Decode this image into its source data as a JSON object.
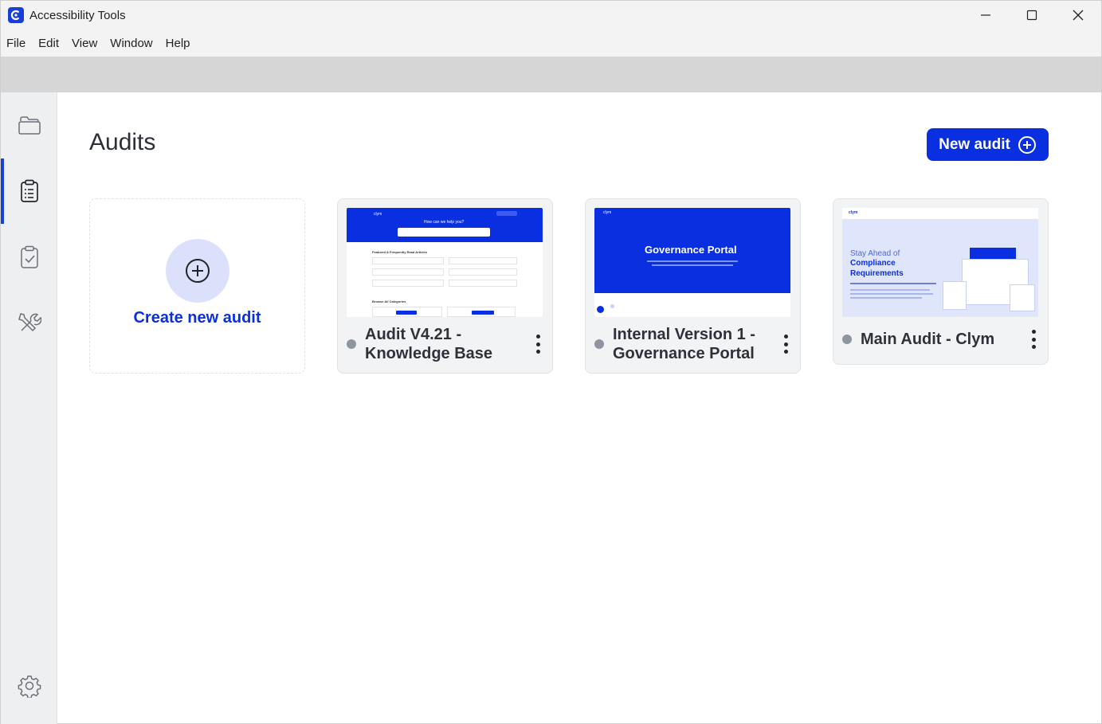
{
  "window": {
    "title": "Accessibility Tools",
    "controls": [
      "minimize-icon",
      "maximize-icon",
      "close-icon"
    ]
  },
  "menu": [
    "File",
    "Edit",
    "View",
    "Window",
    "Help"
  ],
  "sidebar": {
    "items": [
      {
        "name": "folder-icon",
        "active": false
      },
      {
        "name": "clipboard-list-icon",
        "active": true
      },
      {
        "name": "clipboard-check-icon",
        "active": false
      },
      {
        "name": "tools-icon",
        "active": false
      }
    ],
    "bottom": {
      "name": "gear-icon"
    }
  },
  "main": {
    "title": "Audits",
    "new_audit_label": "New audit",
    "create_label": "Create new audit",
    "audits": [
      {
        "name": "Audit V4.21 - Knowledge Base",
        "thumbnail": {
          "heading": "How can we help you?",
          "section1": "Featured & Frequently Read Articles",
          "section2": "Browse All Categories"
        }
      },
      {
        "name": "Internal Version 1 - Governance Portal",
        "thumbnail": {
          "heading": "Governance Portal"
        }
      },
      {
        "name": "Main Audit - Clym",
        "thumbnail": {
          "line1": "Stay Ahead of",
          "line2": "Compliance",
          "line3": "Requirements"
        }
      }
    ]
  },
  "colors": {
    "accent": "#0a2fe0",
    "status_idle": "#8f959e",
    "sidebar_bg": "#eeeff1"
  }
}
